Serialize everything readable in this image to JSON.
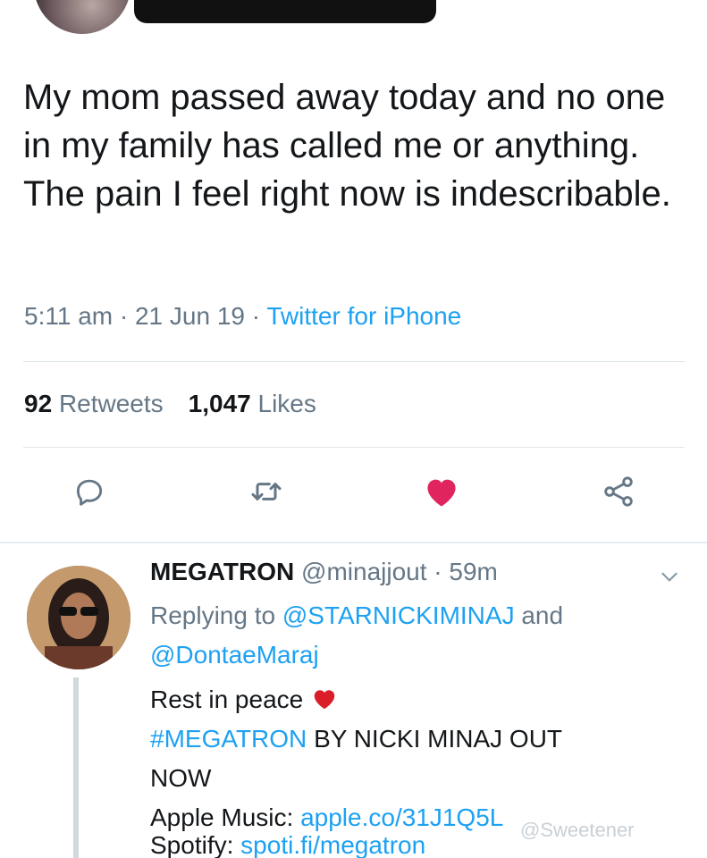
{
  "tweet": {
    "text": "My mom passed away today and no one in my family has called me or anything. The pain I feel right now is indescribable.",
    "time": "5:11 am",
    "dot": "·",
    "date": "21 Jun 19",
    "source": "Twitter for iPhone",
    "retweet_count": "92",
    "retweet_label": "Retweets",
    "like_count": "1,047",
    "like_label": "Likes"
  },
  "actions": {
    "reply_icon": "reply-icon",
    "retweet_icon": "retweet-icon",
    "like_icon": "heart-icon",
    "share_icon": "share-icon",
    "like_color": "#e0245e"
  },
  "reply": {
    "name": "MEGATRON",
    "handle": "@minajjout",
    "dot": "·",
    "time": "59m",
    "replying_to_label": "Replying to",
    "mention_1": "@STARNICKIMINAJ",
    "and_label": "and",
    "mention_2": "@DontaeMaraj",
    "line_1": "Rest in peace",
    "hashtag": "#MEGATRON",
    "line_2_rest": "BY NICKI MINAJ OUT",
    "line_3": "NOW",
    "apple_label": "Apple Music:",
    "apple_link": "apple.co/31J1Q5L",
    "spotify_label": "Spotify:",
    "spotify_link": "spoti.fi/megatron"
  },
  "watermark": "@Sweetener",
  "colors": {
    "accent": "#1da1f2",
    "muted": "#657786",
    "text": "#14171a",
    "heart": "#e0245e"
  }
}
